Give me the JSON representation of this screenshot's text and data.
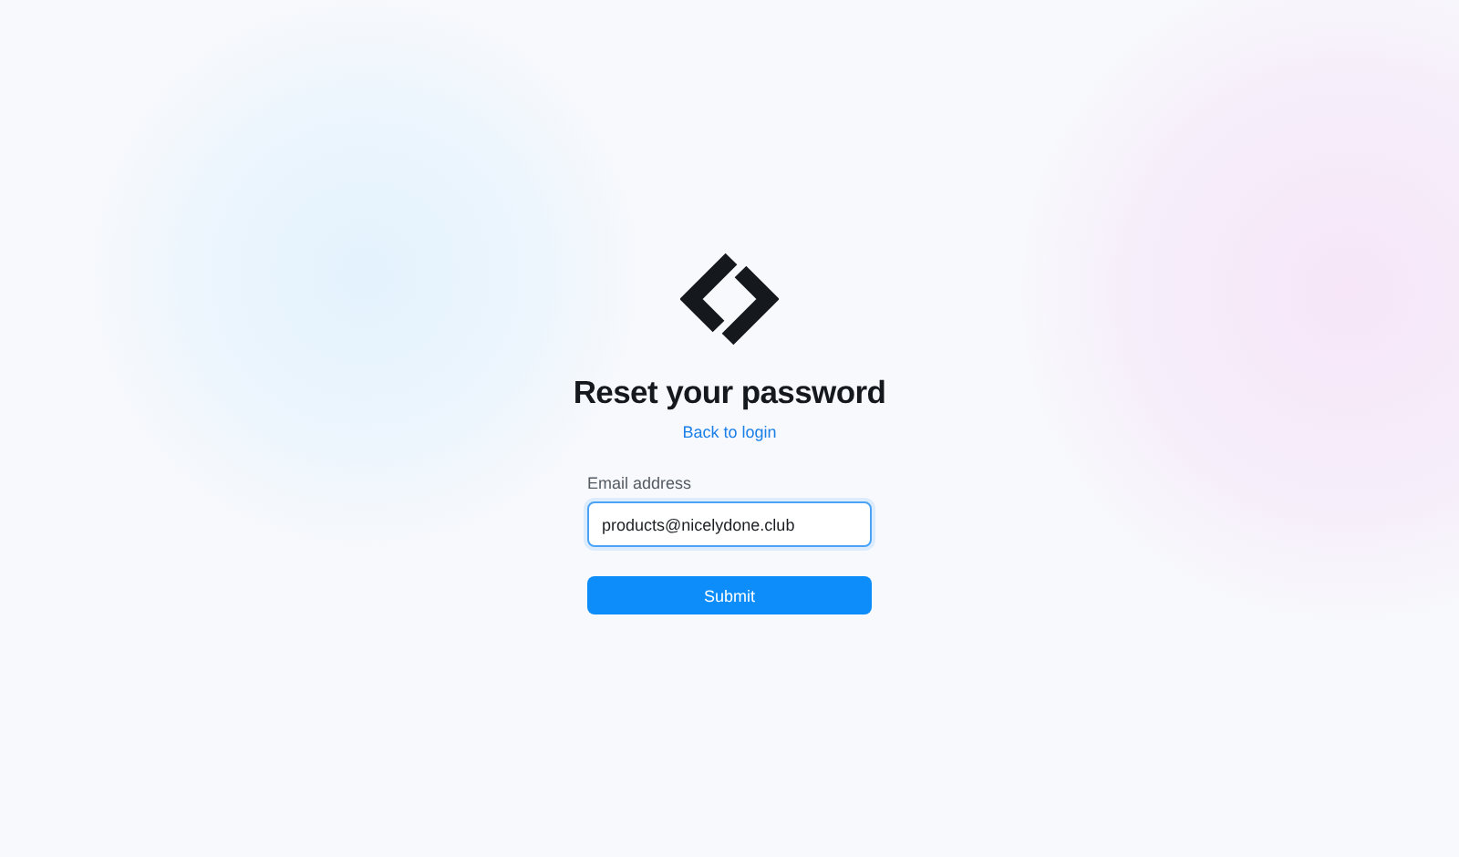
{
  "title": "Reset your password",
  "back_link": "Back to login",
  "email": {
    "label": "Email address",
    "value": "products@nicelydone.club",
    "focused": true
  },
  "submit_button": "Submit"
}
